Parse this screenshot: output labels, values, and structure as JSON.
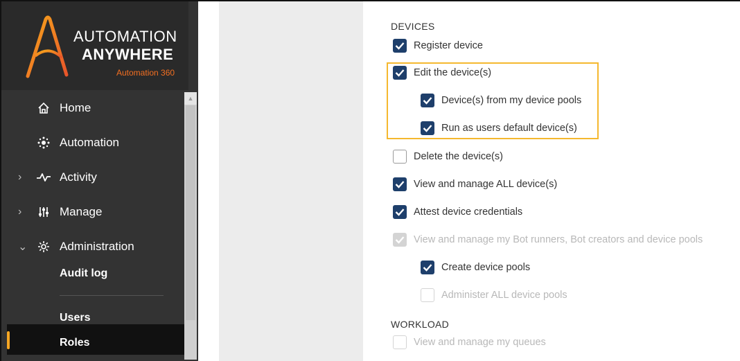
{
  "brand": {
    "line1": "AUTOMATION",
    "line2": "ANYWHERE",
    "line3": "Automation 360",
    "accent": "#f36f21"
  },
  "nav": {
    "home": {
      "label": "Home",
      "icon": "home-icon"
    },
    "automation": {
      "label": "Automation",
      "icon": "automation-icon"
    },
    "activity": {
      "label": "Activity",
      "icon": "activity-icon"
    },
    "manage": {
      "label": "Manage",
      "icon": "sliders-icon"
    },
    "administration": {
      "label": "Administration",
      "icon": "gear-icon"
    },
    "sub": {
      "audit_log": "Audit log",
      "users": "Users",
      "roles": "Roles"
    }
  },
  "devices": {
    "section_label": "DEVICES",
    "register": {
      "label": "Register device",
      "checked": true
    },
    "edit": {
      "label": "Edit the device(s)",
      "checked": true
    },
    "from_pools": {
      "label": "Device(s) from my device pools",
      "checked": true
    },
    "run_as": {
      "label": "Run as users default device(s)",
      "checked": true
    },
    "delete": {
      "label": "Delete the device(s)",
      "checked": false
    },
    "view_all": {
      "label": "View and manage ALL device(s)",
      "checked": true
    },
    "attest": {
      "label": "Attest device credentials",
      "checked": true
    },
    "view_my": {
      "label": "View and manage my Bot runners, Bot creators and device pools",
      "checked": true,
      "disabled": true
    },
    "create_pools": {
      "label": "Create device pools",
      "checked": true
    },
    "administer_pools": {
      "label": "Administer ALL device pools",
      "checked": false,
      "disabled": true
    }
  },
  "workload": {
    "section_label": "WORKLOAD",
    "view_queues": {
      "label": "View and manage my queues",
      "checked": false,
      "disabled": true
    }
  },
  "colors": {
    "checkbox": "#1e3f6b",
    "highlight": "#f5b82e",
    "active_indicator": "#f5a623"
  }
}
